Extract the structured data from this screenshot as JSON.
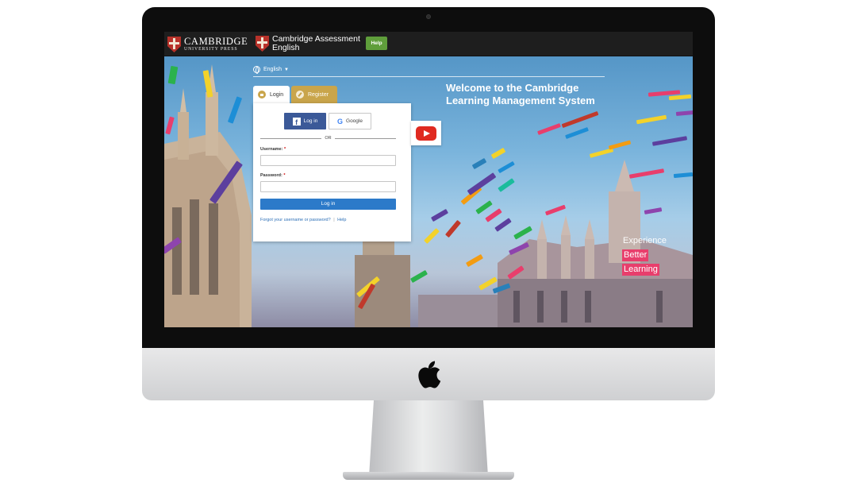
{
  "topbar": {
    "cup_name": "CAMBRIDGE",
    "cup_sub": "UNIVERSITY PRESS",
    "ca_line1": "Cambridge Assessment",
    "ca_line2": "English",
    "help_label": "Help"
  },
  "language": {
    "selected": "English"
  },
  "tabs": {
    "login": "Login",
    "register": "Register"
  },
  "login_panel": {
    "facebook_label": "Log in",
    "google_label": "Google",
    "or_text": "OR",
    "username_label": "Username:",
    "password_label": "Password:",
    "required_mark": "*",
    "login_button": "Log in",
    "forgot_link": "Forgot your username or password?",
    "separator": "|",
    "help_link": "Help"
  },
  "welcome_text": "Welcome to the Cambridge Learning Management System",
  "tagline": {
    "line1": "Experience",
    "line2": "Better",
    "line3": "Learning"
  },
  "colors": {
    "accent_blue": "#2c7ac9",
    "brand_gold": "#c9a54b",
    "help_green": "#5f9e3b",
    "tagline_pink": "#e83e6c"
  }
}
